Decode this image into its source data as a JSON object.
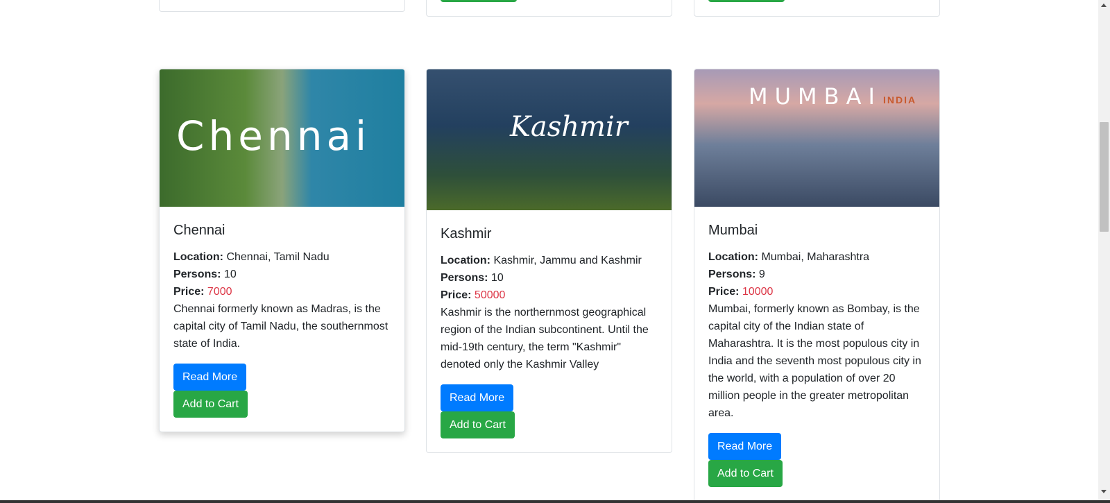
{
  "cards": [
    {
      "image_text": "Chennai",
      "title": "Chennai",
      "location_label": "Location:",
      "location": "Chennai, Tamil Nadu",
      "persons_label": "Persons:",
      "persons": "10",
      "price_label": "Price:",
      "price": "7000",
      "description": "Chennai formerly known as Madras, is the capital city of Tamil Nadu, the southernmost state of India.",
      "read_more": "Read More",
      "add_to_cart": "Add to Cart"
    },
    {
      "image_text": "Kashmir",
      "title": "Kashmir",
      "location_label": "Location:",
      "location": "Kashmir, Jammu and Kashmir",
      "persons_label": "Persons:",
      "persons": "10",
      "price_label": "Price:",
      "price": "50000",
      "description": "Kashmir is the northernmost geographical region of the Indian subcontinent. Until the mid-19th century, the term \"Kashmir\" denoted only the Kashmir Valley",
      "read_more": "Read More",
      "add_to_cart": "Add to Cart"
    },
    {
      "image_text": "MUMBAI",
      "image_subtext": "INDIA",
      "title": "Mumbai",
      "location_label": "Location:",
      "location": "Mumbai, Maharashtra",
      "persons_label": "Persons:",
      "persons": "9",
      "price_label": "Price:",
      "price": "10000",
      "description": "Mumbai, formerly known as Bombay, is the capital city of the Indian state of Maharashtra. It is the most populous city in India and the seventh most populous city in the world, with a population of over 20 million people in the greater metropolitan area.",
      "read_more": "Read More",
      "add_to_cart": "Add to Cart"
    }
  ],
  "colors": {
    "primary": "#007bff",
    "success": "#28a745",
    "price": "#dc3545"
  }
}
